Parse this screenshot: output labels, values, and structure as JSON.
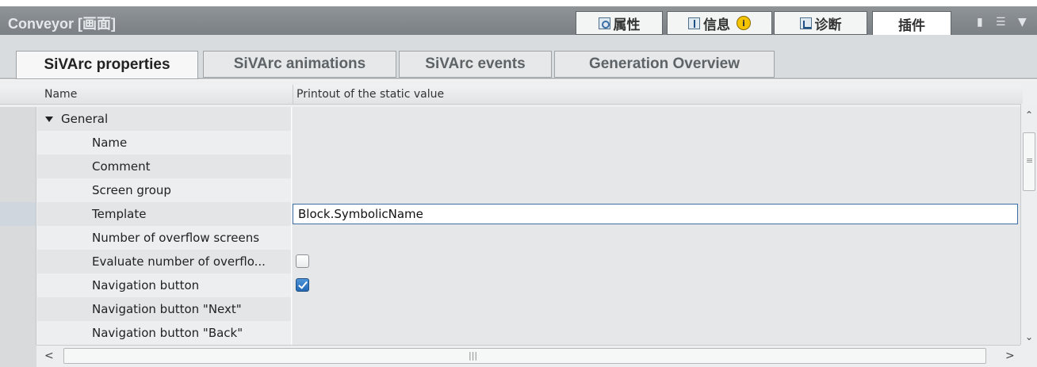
{
  "window": {
    "title": "Conveyor [画面]",
    "tabs": [
      {
        "label": "属性",
        "icon": "properties-icon"
      },
      {
        "label": "信息",
        "icon": "info-icon",
        "badge": "i"
      },
      {
        "label": "诊断",
        "icon": "diagnostics-icon"
      },
      {
        "label": "插件",
        "active": true
      }
    ]
  },
  "subtabs": [
    {
      "label": "SiVArc properties",
      "active": true
    },
    {
      "label": "SiVArc animations"
    },
    {
      "label": "SiVArc events"
    },
    {
      "label": "Generation Overview"
    }
  ],
  "grid": {
    "columns": [
      "Name",
      "Printout of the static value"
    ],
    "rows": [
      {
        "name": "General",
        "group": true,
        "value": ""
      },
      {
        "name": "Name",
        "value": ""
      },
      {
        "name": "Comment",
        "value": ""
      },
      {
        "name": "Screen group",
        "value": ""
      },
      {
        "name": "Template",
        "value": "Block.SymbolicName",
        "editing": true
      },
      {
        "name": "Number of overflow screens",
        "value": ""
      },
      {
        "name": "Evaluate number of overflo...",
        "checkbox": false
      },
      {
        "name": "Navigation button",
        "checkbox": true
      },
      {
        "name": "Navigation button \"Next\"",
        "value": ""
      },
      {
        "name": "Navigation button \"Back\"",
        "value": ""
      }
    ]
  },
  "colors": {
    "title_bar": "#7f8488",
    "selection_border": "#3a6ea5",
    "checkbox_checked": "#2f7cc8"
  }
}
